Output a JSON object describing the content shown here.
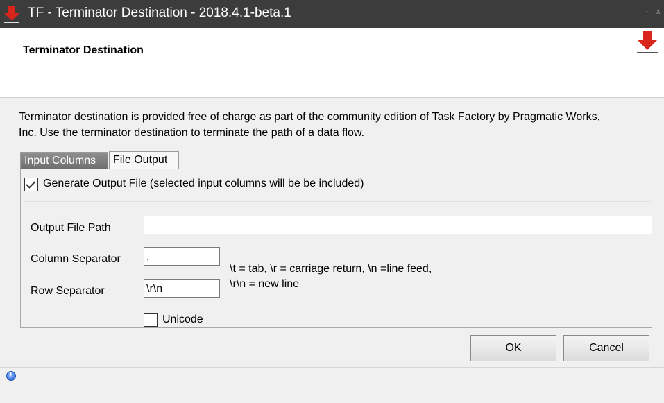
{
  "window": {
    "title": "TF - Terminator Destination - 2018.4.1-beta.1",
    "minimize": "-",
    "close": "x",
    "app_icon": "download-arrow-icon"
  },
  "header": {
    "title": "Terminator Destination",
    "icon": "download-arrow-icon"
  },
  "description": {
    "line1": "Terminator destination is provided free of charge as part of the community edition of Task Factory by Pragmatic Works,",
    "line2": "Inc. Use the terminator destination to terminate the path of a data flow."
  },
  "tabs": [
    {
      "label": "Input Columns",
      "active": false
    },
    {
      "label": "File Output",
      "active": true
    }
  ],
  "file_output": {
    "generate_checkbox": {
      "label": "Generate Output File (selected input columns will be be included)",
      "checked": true
    },
    "output_file_path": {
      "label": "Output File Path",
      "value": ""
    },
    "column_separator": {
      "label": "Column Separator",
      "value": ","
    },
    "row_separator": {
      "label": "Row Separator",
      "value": "\\r\\n"
    },
    "hint": {
      "line1": "\\t = tab, \\r = carriage return, \\n =line feed,",
      "line2": "\\r\\n = new line"
    },
    "unicode_checkbox": {
      "label": "Unicode",
      "checked": false
    }
  },
  "buttons": {
    "ok": "OK",
    "cancel": "Cancel"
  },
  "status": {
    "icon": "info-icon",
    "info_glyph": "!"
  },
  "colors": {
    "titlebar_bg": "#3c3c3c",
    "arrow_red": "#d9261c",
    "info_blue": "#1f5fd8"
  }
}
